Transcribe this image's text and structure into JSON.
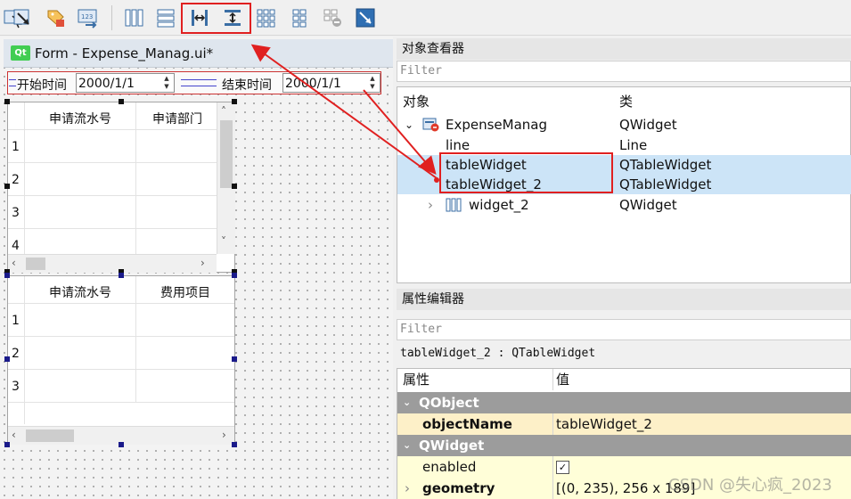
{
  "toolbar": {
    "buttons": [
      "edit-widgets",
      "edit-signals-slots",
      "edit-buddies",
      "edit-tab-order",
      "layout-horizontal",
      "layout-vertical",
      "layout-horizontal-splitter",
      "layout-vertical-splitter",
      "layout-grid",
      "layout-form",
      "break-layout",
      "adjust-size"
    ]
  },
  "form": {
    "logo": "Qt",
    "title": "Form - Expense_Manag.ui*",
    "start_label": "开始时间",
    "start_date": "2000/1/1",
    "end_label": "结束时间",
    "end_date": "2000/1/1"
  },
  "table1": {
    "headers": [
      "申请流水号",
      "申请部门"
    ],
    "rows": [
      "1",
      "2",
      "3",
      "4"
    ]
  },
  "table2": {
    "headers": [
      "申请流水号",
      "费用项目"
    ],
    "rows": [
      "1",
      "2",
      "3"
    ]
  },
  "object_inspector": {
    "title": "对象查看器",
    "filter_placeholder": "Filter",
    "col_object": "对象",
    "col_class": "类",
    "items": [
      {
        "name": "ExpenseManag",
        "cls": "QWidget"
      },
      {
        "name": "line",
        "cls": "Line"
      },
      {
        "name": "tableWidget",
        "cls": "QTableWidget"
      },
      {
        "name": "tableWidget_2",
        "cls": "QTableWidget"
      },
      {
        "name": "widget_2",
        "cls": "QWidget"
      }
    ]
  },
  "property_editor": {
    "title": "属性编辑器",
    "filter_placeholder": "Filter",
    "context": "tableWidget_2 : QTableWidget",
    "col_property": "属性",
    "col_value": "值",
    "group_qobject": "QObject",
    "object_name_label": "objectName",
    "object_name_value": "tableWidget_2",
    "group_qwidget": "QWidget",
    "enabled_label": "enabled",
    "enabled_value": true,
    "geometry_label": "geometry",
    "geometry_value": "[(0, 235), 256 x 189]"
  },
  "watermark": "CSDN @失心疯_2023",
  "colors": {
    "annotation_red": "#e02020",
    "selection": "#cce4f7",
    "group_header": "#9c9c9c",
    "property_row": "#fffed8"
  }
}
